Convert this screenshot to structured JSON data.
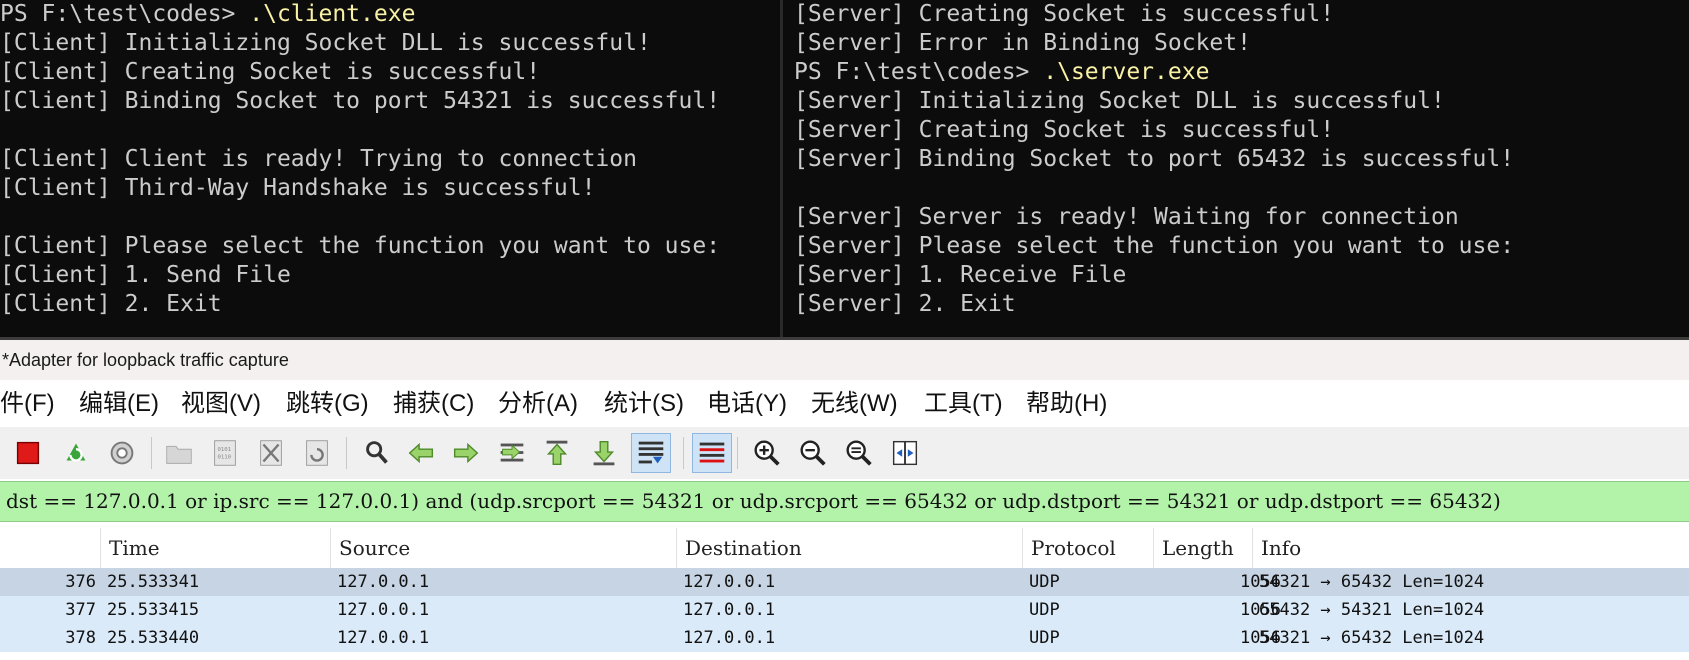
{
  "client_terminal": {
    "lines": [
      {
        "prompt": "PS F:\\test\\codes> ",
        "cmd": ".\\client.exe"
      },
      {
        "text": "[Client] Initializing Socket DLL is successful!"
      },
      {
        "text": "[Client] Creating Socket is successful!"
      },
      {
        "text": "[Client] Binding Socket to port 54321 is successful!"
      },
      {
        "text": ""
      },
      {
        "text": "[Client] Client is ready! Trying to connection"
      },
      {
        "text": "[Client] Third-Way Handshake is successful!"
      },
      {
        "text": ""
      },
      {
        "text": "[Client] Please select the function you want to use:"
      },
      {
        "text": "[Client] 1. Send File"
      },
      {
        "text": "[Client] 2. Exit"
      }
    ]
  },
  "server_terminal": {
    "lines": [
      {
        "text": "[Server] Creating Socket is successful!"
      },
      {
        "text": "[Server] Error in Binding Socket!"
      },
      {
        "prompt": "PS F:\\test\\codes> ",
        "cmd": ".\\server.exe"
      },
      {
        "text": "[Server] Initializing Socket DLL is successful!"
      },
      {
        "text": "[Server] Creating Socket is successful!"
      },
      {
        "text": "[Server] Binding Socket to port 65432 is successful!"
      },
      {
        "text": ""
      },
      {
        "text": "[Server] Server is ready! Waiting for connection"
      },
      {
        "text": "[Server] Please select the function you want to use:"
      },
      {
        "text": "[Server] 1. Receive File"
      },
      {
        "text": "[Server] 2. Exit"
      }
    ]
  },
  "wireshark": {
    "title": "*Adapter for loopback traffic capture",
    "menu": [
      "件(F)",
      "编辑(E)",
      "视图(V)",
      "跳转(G)",
      "捕获(C)",
      "分析(A)",
      "统计(S)",
      "电话(Y)",
      "无线(W)",
      "工具(T)",
      "帮助(H)"
    ],
    "toolbar_icons": [
      "stop-capture-icon",
      "restart-capture-icon",
      "capture-options-icon",
      "open-file-icon",
      "save-file-icon",
      "close-file-icon",
      "reload-file-icon",
      "find-packet-icon",
      "go-back-icon",
      "go-forward-icon",
      "go-to-packet-icon",
      "first-packet-icon",
      "last-packet-icon",
      "auto-scroll-icon",
      "colorize-icon",
      "zoom-in-icon",
      "zoom-out-icon",
      "zoom-normal-icon",
      "resize-columns-icon"
    ],
    "filter": "dst == 127.0.0.1 or ip.src == 127.0.0.1) and (udp.srcport == 54321 or udp.srcport == 65432 or udp.dstport == 54321 or udp.dstport == 65432)",
    "columns": [
      "Time",
      "Source",
      "Destination",
      "Protocol",
      "Length",
      "Info"
    ],
    "packets": [
      {
        "no": "376",
        "time": "25.533341",
        "src": "127.0.0.1",
        "dst": "127.0.0.1",
        "proto": "UDP",
        "len": "1056",
        "info": "54321 → 65432 Len=1024"
      },
      {
        "no": "377",
        "time": "25.533415",
        "src": "127.0.0.1",
        "dst": "127.0.0.1",
        "proto": "UDP",
        "len": "1056",
        "info": "65432 → 54321 Len=1024"
      },
      {
        "no": "378",
        "time": "25.533440",
        "src": "127.0.0.1",
        "dst": "127.0.0.1",
        "proto": "UDP",
        "len": "1056",
        "info": "54321 → 65432 Len=1024"
      }
    ],
    "row_colors": [
      "#c6d4e3",
      "#dbeaf8",
      "#dbeaf8"
    ]
  }
}
